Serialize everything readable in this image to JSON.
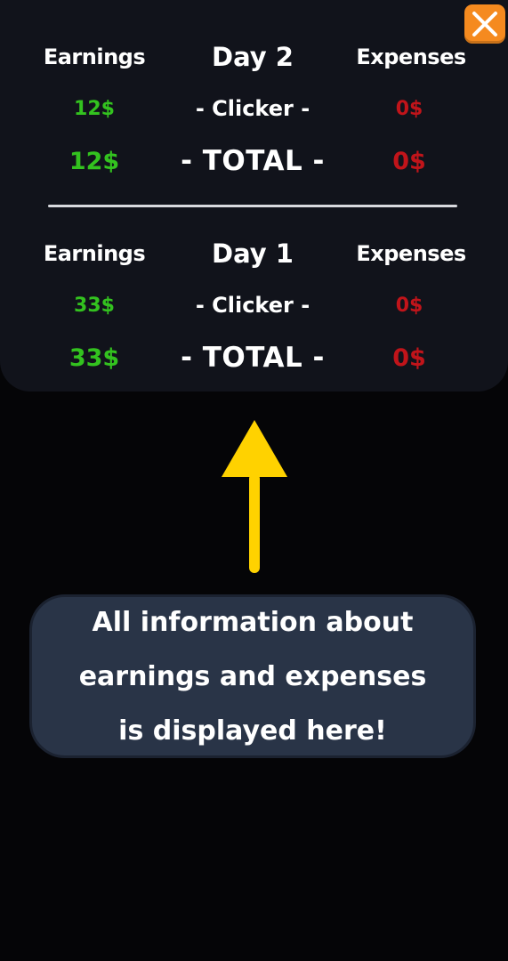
{
  "colors": {
    "background": "#050507",
    "panel": "#11131b",
    "earnings_green": "#33c21f",
    "expenses_red": "#c1141a",
    "close_button": "#f58a1f",
    "arrow_yellow": "#ffd200",
    "tip_box": "#293447"
  },
  "close_button": {
    "icon": "close-icon"
  },
  "days": [
    {
      "earnings_header": "Earnings",
      "title": "Day 2",
      "expenses_header": "Expenses",
      "rows": [
        {
          "earnings": "12$",
          "label": "- Clicker -",
          "expenses": "0$"
        }
      ],
      "total": {
        "earnings": "12$",
        "label": "- TOTAL -",
        "expenses": "0$"
      }
    },
    {
      "earnings_header": "Earnings",
      "title": "Day 1",
      "expenses_header": "Expenses",
      "rows": [
        {
          "earnings": "33$",
          "label": "- Clicker -",
          "expenses": "0$"
        }
      ],
      "total": {
        "earnings": "33$",
        "label": "- TOTAL -",
        "expenses": "0$"
      }
    }
  ],
  "tutorial": {
    "arrow_icon": "up-arrow-icon",
    "message": "All information about\nearnings and expenses\nis displayed here!"
  }
}
